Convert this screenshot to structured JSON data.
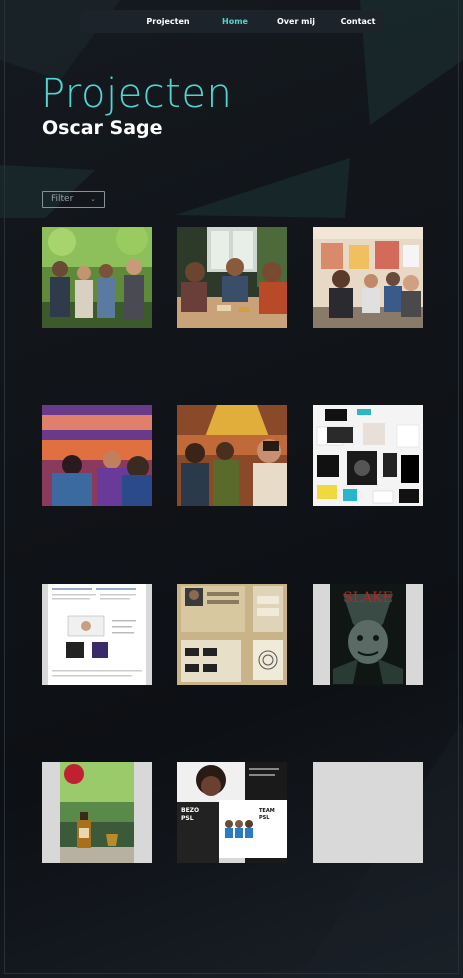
{
  "nav": {
    "items": [
      {
        "label": "Projecten"
      },
      {
        "label": "Home"
      },
      {
        "label": "Over mij"
      },
      {
        "label": "Contact"
      }
    ],
    "active_color": "#4fd6cf"
  },
  "header": {
    "title": "Projecten",
    "subtitle": "Oscar Sage"
  },
  "filter": {
    "label": "Filter",
    "icon": "chevron-down-icon"
  },
  "projects": [
    {
      "thumbnail": "group-outdoors-photo"
    },
    {
      "thumbnail": "meeting-table-photo"
    },
    {
      "thumbnail": "office-discussion-photo"
    },
    {
      "thumbnail": "lecture-hall-illustration"
    },
    {
      "thumbnail": "audience-illustration"
    },
    {
      "thumbnail": "moodboard-screenshot"
    },
    {
      "thumbnail": "document-screenshot"
    },
    {
      "thumbnail": "app-wireframe-screenshot"
    },
    {
      "thumbnail": "horror-poster"
    },
    {
      "thumbnail": "product-bottle-photo"
    },
    {
      "thumbnail": "social-media-collage"
    },
    {
      "thumbnail": "empty-placeholder"
    }
  ],
  "colors": {
    "accent": "#4fd6cf",
    "background": "#101317",
    "nav_background": "#1d232b"
  }
}
